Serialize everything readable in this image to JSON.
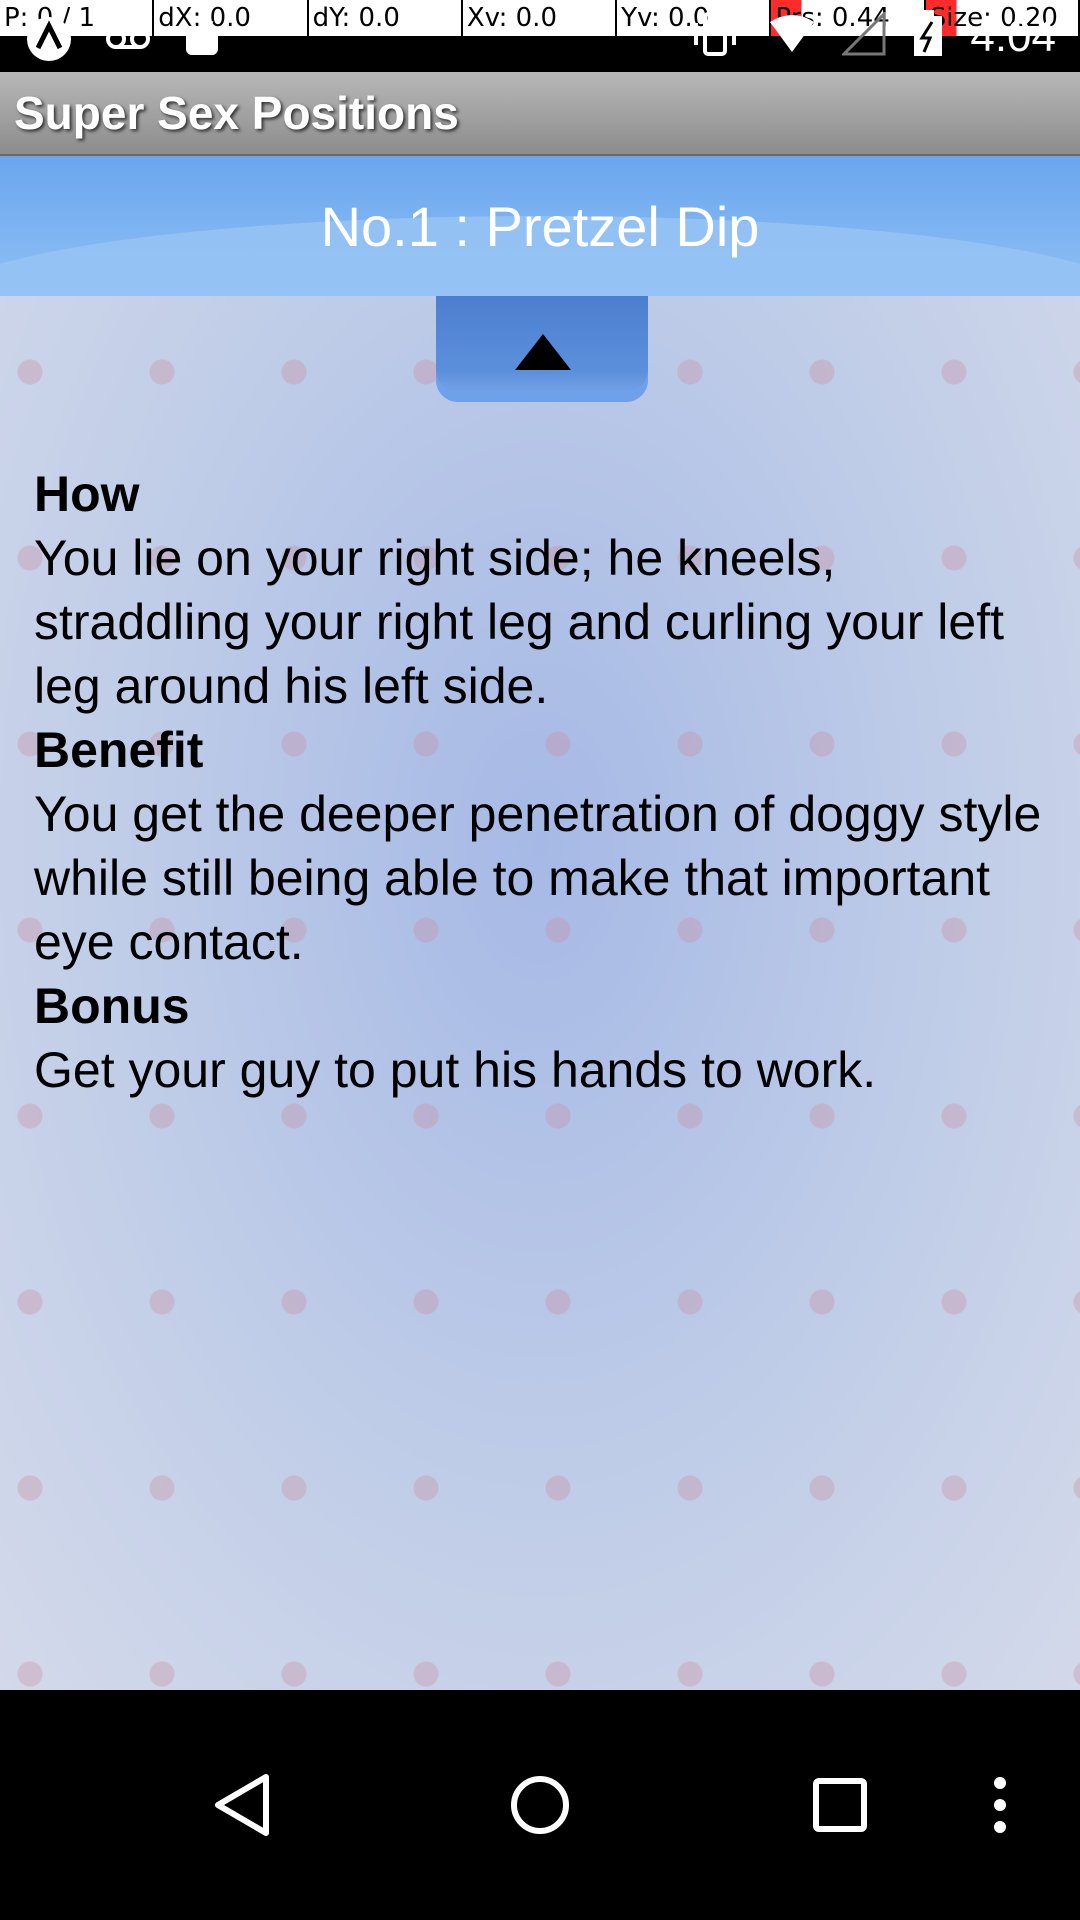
{
  "status_bar": {
    "debug": [
      "P: 0 / 1",
      "dX: 0.0",
      "dY: 0.0",
      "Xv: 0.0",
      "Yv: 0.0",
      "Prs: 0.44",
      "Size: 0.20"
    ],
    "time": "4:04",
    "icons_left": [
      "app-icon",
      "voicemail-icon",
      "android-icon"
    ],
    "icons_right": [
      "vibrate-icon",
      "wifi-icon",
      "signal-icon",
      "battery-icon"
    ]
  },
  "app": {
    "title": "Super Sex Positions"
  },
  "position": {
    "title": "No.1 : Pretzel Dip",
    "sections": [
      {
        "heading": "How",
        "text": "You lie on your right side; he kneels, straddling your right leg and curling your left leg around his left side."
      },
      {
        "heading": "Benefit",
        "text": "You get the deeper penetration of doggy style while still being able to make that important eye contact."
      },
      {
        "heading": "Bonus",
        "text": "Get your guy to put his hands to work."
      }
    ]
  },
  "nav": {
    "buttons": [
      "back-icon",
      "home-icon",
      "recents-icon",
      "overflow-menu-icon"
    ]
  },
  "colors": {
    "banner": "#7ab2f0",
    "title_bar": "#a6a6a6",
    "content_bg": "#b9c8ea"
  }
}
